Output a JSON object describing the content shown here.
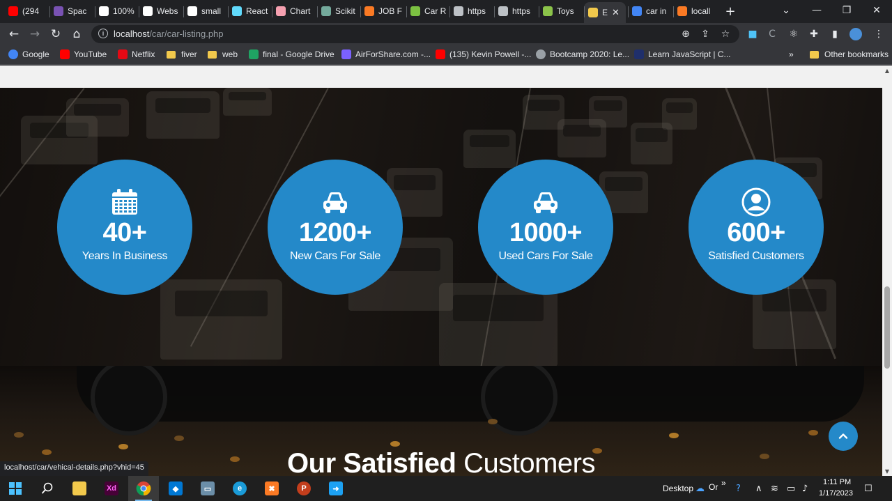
{
  "tabs": [
    {
      "label": "(294",
      "icon": "youtube-icon",
      "color": "#ff0000"
    },
    {
      "label": "Spac",
      "icon": "bootstrap-icon",
      "color": "#7952b3"
    },
    {
      "label": "100%",
      "icon": "sst-icon",
      "color": "#ffffff"
    },
    {
      "label": "Webs",
      "icon": "sst-icon",
      "color": "#ffffff"
    },
    {
      "label": "small",
      "icon": "sst-icon",
      "color": "#ffffff"
    },
    {
      "label": "React",
      "icon": "react-icon",
      "color": "#61dafb"
    },
    {
      "label": "Chart",
      "icon": "cube-icon",
      "color": "#f5a0b0"
    },
    {
      "label": "Scikit",
      "icon": "chatgpt-icon",
      "color": "#74aa9c"
    },
    {
      "label": "JOB F",
      "icon": "xampp-icon",
      "color": "#fb7a24"
    },
    {
      "label": "Car R",
      "icon": "leaf-icon",
      "color": "#7cc142"
    },
    {
      "label": "https",
      "icon": "globe-icon",
      "color": "#bdc1c6"
    },
    {
      "label": "https",
      "icon": "globe-icon",
      "color": "#bdc1c6"
    },
    {
      "label": "Toys",
      "icon": "toys-icon",
      "color": "#8bc34a"
    },
    {
      "label": "E",
      "icon": "page-icon",
      "color": "#f2c94c",
      "active": true
    },
    {
      "label": "car in",
      "icon": "google-icon",
      "color": "#4285f4"
    },
    {
      "label": "locall",
      "icon": "xampp-mountain-icon",
      "color": "#fb7a24"
    }
  ],
  "address_bar": {
    "host": "localhost",
    "path": "/car/car-listing.php"
  },
  "bookmarks": [
    {
      "label": "Google",
      "icon": "google-icon"
    },
    {
      "label": "YouTube",
      "icon": "youtube-icon"
    },
    {
      "label": "Netflix",
      "icon": "netflix-icon"
    },
    {
      "label": "fiver",
      "icon": "folder-icon"
    },
    {
      "label": "web",
      "icon": "folder-icon"
    },
    {
      "label": "final - Google Drive",
      "icon": "drive-icon"
    },
    {
      "label": "AirForShare.com -...",
      "icon": "airforshare-icon"
    },
    {
      "label": "(135) Kevin Powell -...",
      "icon": "youtube-icon"
    },
    {
      "label": "Bootcamp 2020: Le...",
      "icon": "globe-icon"
    },
    {
      "label": "Learn JavaScript | C...",
      "icon": "codecademy-icon"
    }
  ],
  "bookmarks_overflow": "»",
  "other_bookmarks": "Other bookmarks",
  "stats": [
    {
      "number": "40+",
      "label": "Years In Business",
      "icon": "calendar-icon"
    },
    {
      "number": "1200+",
      "label": "New Cars For Sale",
      "icon": "car-icon"
    },
    {
      "number": "1000+",
      "label": "Used Cars For Sale",
      "icon": "car-icon"
    },
    {
      "number": "600+",
      "label": "Satisfied Customers",
      "icon": "user-circle-icon"
    }
  ],
  "section_heading": {
    "bold": "Our Satisfied",
    "light": "Customers"
  },
  "status_url": "localhost/car/vehical-details.php?vhid=45",
  "taskbar": {
    "desktop_label": "Desktop",
    "onedrive_label": "Or",
    "time": "1:11 PM",
    "date": "1/17/2023"
  },
  "colors": {
    "accent": "#2489c9",
    "browser_dark": "#202124",
    "toolbar": "#35363a"
  }
}
